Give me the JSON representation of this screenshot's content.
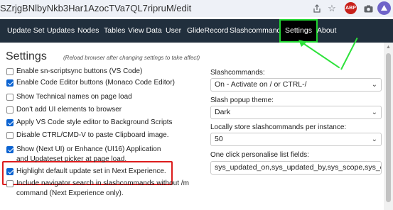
{
  "browser": {
    "url": "SZrjgBNlbyNkb3Har1AzocTVa7QL7ripruM/edit",
    "abp_label": "ABP"
  },
  "nav": {
    "items": [
      "Update Set",
      "Updates",
      "Nodes",
      "Tables",
      "View Data",
      "User",
      "GlideRecord",
      "Slashcommands",
      "Settings",
      "About"
    ],
    "active": "Settings"
  },
  "settings": {
    "title": "Settings",
    "note": "(Reload browser after changing settings to take affect)",
    "options": [
      {
        "label": "Enable sn-scriptsync buttons (VS Code)",
        "checked": false
      },
      {
        "label": "Enable Code Editor buttons (Monaco Code Editor)",
        "checked": true
      },
      {
        "label": "Show Technical names on page load",
        "checked": false
      },
      {
        "label": "Don't add UI elements to browser",
        "checked": false
      },
      {
        "label": "Apply VS Code style editor to Background Scripts",
        "checked": true
      },
      {
        "label": "Disable CTRL/CMD-V to paste Clipboard image.",
        "checked": false
      },
      {
        "label": "Show (Next UI) or Enhance (UI16) Application and Updateset picker at page load.",
        "checked": true
      },
      {
        "label": "Highlight default update set in Next Experience.",
        "checked": true
      },
      {
        "label": "Include navigator search in slashcommands without /m command (Next Experience only).",
        "checked": false
      }
    ]
  },
  "right": {
    "slashcommands_label": "Slashcommands:",
    "slashcommands_value": "On - Activate on / or CTRL-/",
    "theme_label": "Slash popup theme:",
    "theme_value": "Dark",
    "store_label": "Locally store slashcommands per instance:",
    "store_value": "50",
    "listfields_label": "One click personalise list fields:",
    "listfields_value": "sys_updated_on,sys_updated_by,sys_scope,sys_creat"
  },
  "colors": {
    "navbar": "#212f3d",
    "highlight_green": "#2ee23b",
    "highlight_red": "#dc1c1c",
    "checkbox": "#0b63d1"
  }
}
